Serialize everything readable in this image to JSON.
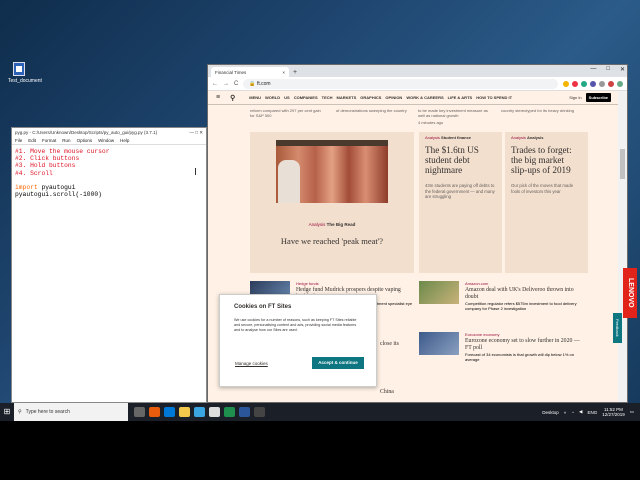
{
  "desktop": {
    "icon_label": "Test_document"
  },
  "idle": {
    "title": "pyg.py - C:/Users/Unknown/Desktop/Scripts/py_auto_gui/pyg.py (3.7.1)",
    "win_controls": "— □ ✕",
    "menu": [
      "File",
      "Edit",
      "Format",
      "Run",
      "Options",
      "Window",
      "Help"
    ],
    "code_comments": [
      "#1. Move the mouse cursor",
      "#2. Click buttons",
      "#3. Hold buttons",
      "#4. Scroll"
    ],
    "code_import_kw": "import",
    "code_import_mod": " pyautogui",
    "code_line": "pyautogui.scroll(-1000)"
  },
  "browser": {
    "tab_title": "Financial Times",
    "tab_close": "×",
    "new_tab": "+",
    "win_controls": [
      "—",
      "□",
      "✕"
    ],
    "url": "ft.com",
    "back": "←",
    "forward": "→",
    "reload": "C"
  },
  "ft": {
    "nav": [
      "MENU",
      "WORLD",
      "US",
      "COMPANIES",
      "TECH",
      "MARKETS",
      "GRAPHICS",
      "OPINION",
      "WORK & CAREERS",
      "LIFE & ARTS",
      "HOW TO SPEND IT"
    ],
    "sign_in": "Sign In",
    "subscribe": "Subscribe",
    "strip": [
      "reform compared with 297 per cent gain for S&P 500",
      "of demonstrations sweeping the country",
      "to be made key investment measure as well as national growth",
      "country stereotyped for its heavy drinking"
    ],
    "strip_time": "4 minutes ago",
    "big_tag_cat": "Analysis",
    "big_tag_name": "The Big Read",
    "big_head": "Have we reached 'peak meat'?",
    "card1": {
      "cat": "Analysis",
      "name": "Student finance",
      "head": "The $1.6tn US student debt nightmare",
      "body": "43m students are paying off debts to the federal government — and many are struggling"
    },
    "card2": {
      "cat": "Analysis",
      "name": "Analysis",
      "head": "Trades to forget: the big market slip-ups of 2019",
      "body": "Our pick of the moves that made fools of investors this year"
    },
    "row1": {
      "tag": "Hedge funds",
      "head": "Hedge fund Mudrick prospers despite vaping backlash",
      "body": "Stake in Juul rival Njoy helps distressed investment specialist eye over 20% gain for year"
    },
    "row2": {
      "tag": "Amazon.com",
      "head": "Amazon deal with UK's Deliveroo thrown into doubt",
      "body": "Competition regulator refers $575m investment to food delivery company for Phase 2 investigation"
    },
    "row3": {
      "tag": "Eurozone economy",
      "head": "Eurozone economy set to slow further in 2020 — FT poll",
      "body": "Forecast of 34 economists is that growth will dip below 1% on average"
    },
    "row4_frag": "close its",
    "row5_frag": "China",
    "row5_body": "capacity of its Model 3 sedan",
    "feedback": "Feedback"
  },
  "cookie": {
    "title": "Cookies on FT Sites",
    "body": "We use cookies for a number of reasons, such as keeping FT Sites reliable and secure, personalising content and ads, providing social media features and to analyse how our Sites are used.",
    "manage": "Manage cookies",
    "accept": "Accept & continue"
  },
  "lenovo": "LENOVO",
  "taskbar": {
    "search_placeholder": "Type here to search",
    "desktop_label": "Desktop",
    "lang": "ENG",
    "time": "11:52 PM",
    "date": "12/27/2019"
  }
}
